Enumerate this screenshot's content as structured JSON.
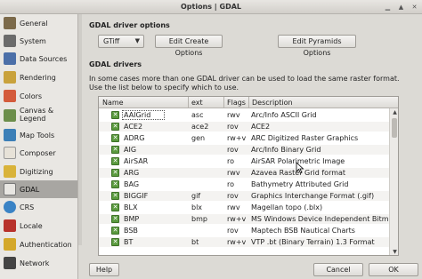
{
  "window": {
    "title": "Options | GDAL"
  },
  "sidebar": {
    "items": [
      {
        "label": "General",
        "icon": "wrench-icon",
        "color": "#7c6a4a"
      },
      {
        "label": "System",
        "icon": "gear-icon",
        "color": "#6b6b6b"
      },
      {
        "label": "Data Sources",
        "icon": "table-icon",
        "color": "#4b6fa8"
      },
      {
        "label": "Rendering",
        "icon": "brush-icon",
        "color": "#c9a23c"
      },
      {
        "label": "Colors",
        "icon": "palette-icon",
        "color": "#d45b3b"
      },
      {
        "label": "Canvas & Legend",
        "icon": "canvas-icon",
        "color": "#6c8e4b"
      },
      {
        "label": "Map Tools",
        "icon": "map-tools-icon",
        "color": "#3c7fb7"
      },
      {
        "label": "Composer",
        "icon": "composer-icon",
        "color": "#e7e2d8"
      },
      {
        "label": "Digitizing",
        "icon": "pencil-icon",
        "color": "#d9b33a"
      },
      {
        "label": "GDAL",
        "icon": "gdal-icon",
        "color": "#e8e6e2"
      },
      {
        "label": "CRS",
        "icon": "globe-icon",
        "color": "#3a83c5"
      },
      {
        "label": "Locale",
        "icon": "flag-icon",
        "color": "#b8322c"
      },
      {
        "label": "Authentication",
        "icon": "lock-icon",
        "color": "#d4a82a"
      },
      {
        "label": "Network",
        "icon": "network-icon",
        "color": "#444444"
      }
    ],
    "selected": "GDAL"
  },
  "driver_options": {
    "heading": "GDAL driver options",
    "selected_driver": "GTiff",
    "edit_create_label": "Edit Create Options",
    "edit_pyramids_label": "Edit Pyramids Options"
  },
  "drivers": {
    "heading": "GDAL drivers",
    "description": "In some cases more than one GDAL driver can be used to load the same raster format. Use the list below to specify which to use.",
    "columns": [
      "Name",
      "ext",
      "Flags",
      "Description"
    ],
    "rows": [
      {
        "name": "AAIGrid",
        "ext": "asc",
        "flags": "rwv",
        "description": "Arc/Info ASCII Grid"
      },
      {
        "name": "ACE2",
        "ext": "ace2",
        "flags": "rov",
        "description": "ACE2"
      },
      {
        "name": "ADRG",
        "ext": "gen",
        "flags": "rw+v",
        "description": "ARC Digitized Raster Graphics"
      },
      {
        "name": "AIG",
        "ext": "",
        "flags": "rov",
        "description": "Arc/Info Binary Grid"
      },
      {
        "name": "AirSAR",
        "ext": "",
        "flags": "ro",
        "description": "AirSAR Polarimetric Image"
      },
      {
        "name": "ARG",
        "ext": "",
        "flags": "rwv",
        "description": "Azavea Raster Grid format"
      },
      {
        "name": "BAG",
        "ext": "",
        "flags": "ro",
        "description": "Bathymetry Attributed Grid"
      },
      {
        "name": "BIGGIF",
        "ext": "gif",
        "flags": "rov",
        "description": "Graphics Interchange Format (.gif)"
      },
      {
        "name": "BLX",
        "ext": "blx",
        "flags": "rwv",
        "description": "Magellan topo (.blx)"
      },
      {
        "name": "BMP",
        "ext": "bmp",
        "flags": "rw+v",
        "description": "MS Windows Device Independent Bitmap"
      },
      {
        "name": "BSB",
        "ext": "",
        "flags": "rov",
        "description": "Maptech BSB Nautical Charts"
      },
      {
        "name": "BT",
        "ext": "bt",
        "flags": "rw+v",
        "description": "VTP .bt (Binary Terrain) 1.3 Format"
      }
    ]
  },
  "footer": {
    "help_label": "Help",
    "cancel_label": "Cancel",
    "ok_label": "OK"
  }
}
